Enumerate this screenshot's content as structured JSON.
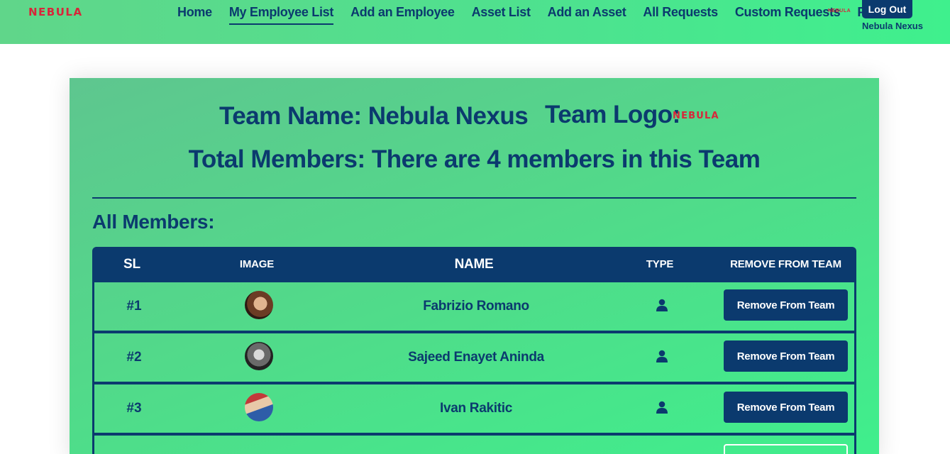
{
  "navbar": {
    "brand": "NEBULA",
    "links": [
      {
        "label": "Home",
        "active": false
      },
      {
        "label": "My Employee List",
        "active": true
      },
      {
        "label": "Add an Employee",
        "active": false
      },
      {
        "label": "Asset List",
        "active": false
      },
      {
        "label": "Add an Asset",
        "active": false
      },
      {
        "label": "All Requests",
        "active": false
      },
      {
        "label": "Custom Requests",
        "active": false
      },
      {
        "label": "Profile",
        "active": false
      }
    ],
    "logo_text": "NEBULA",
    "logout_label": "Log Out",
    "user_name": "Nebula Nexus"
  },
  "team": {
    "name_line": "Team Name: Nebula Nexus",
    "logo_label": "Team Logo:",
    "logo_text": "NEBULA",
    "total_members_line": "Total Members: There are 4 members in this Team"
  },
  "members_section": {
    "title": "All Members:",
    "columns": [
      "SL",
      "IMAGE",
      "NAME",
      "TYPE",
      "REMOVE FROM TEAM"
    ],
    "rows": [
      {
        "sl": "#1",
        "name": "Fabrizio Romano",
        "type_icon": "person-icon",
        "remove_label": "Remove From Team"
      },
      {
        "sl": "#2",
        "name": "Sajeed Enayet Aninda",
        "type_icon": "person-icon",
        "remove_label": "Remove From Team"
      },
      {
        "sl": "#3",
        "name": "Ivan Rakitic",
        "type_icon": "person-icon",
        "remove_label": "Remove From Team"
      }
    ]
  },
  "colors": {
    "primary": "#0b3a6e",
    "accent_green": "#3ff08d",
    "brand_red": "#d8263a"
  }
}
